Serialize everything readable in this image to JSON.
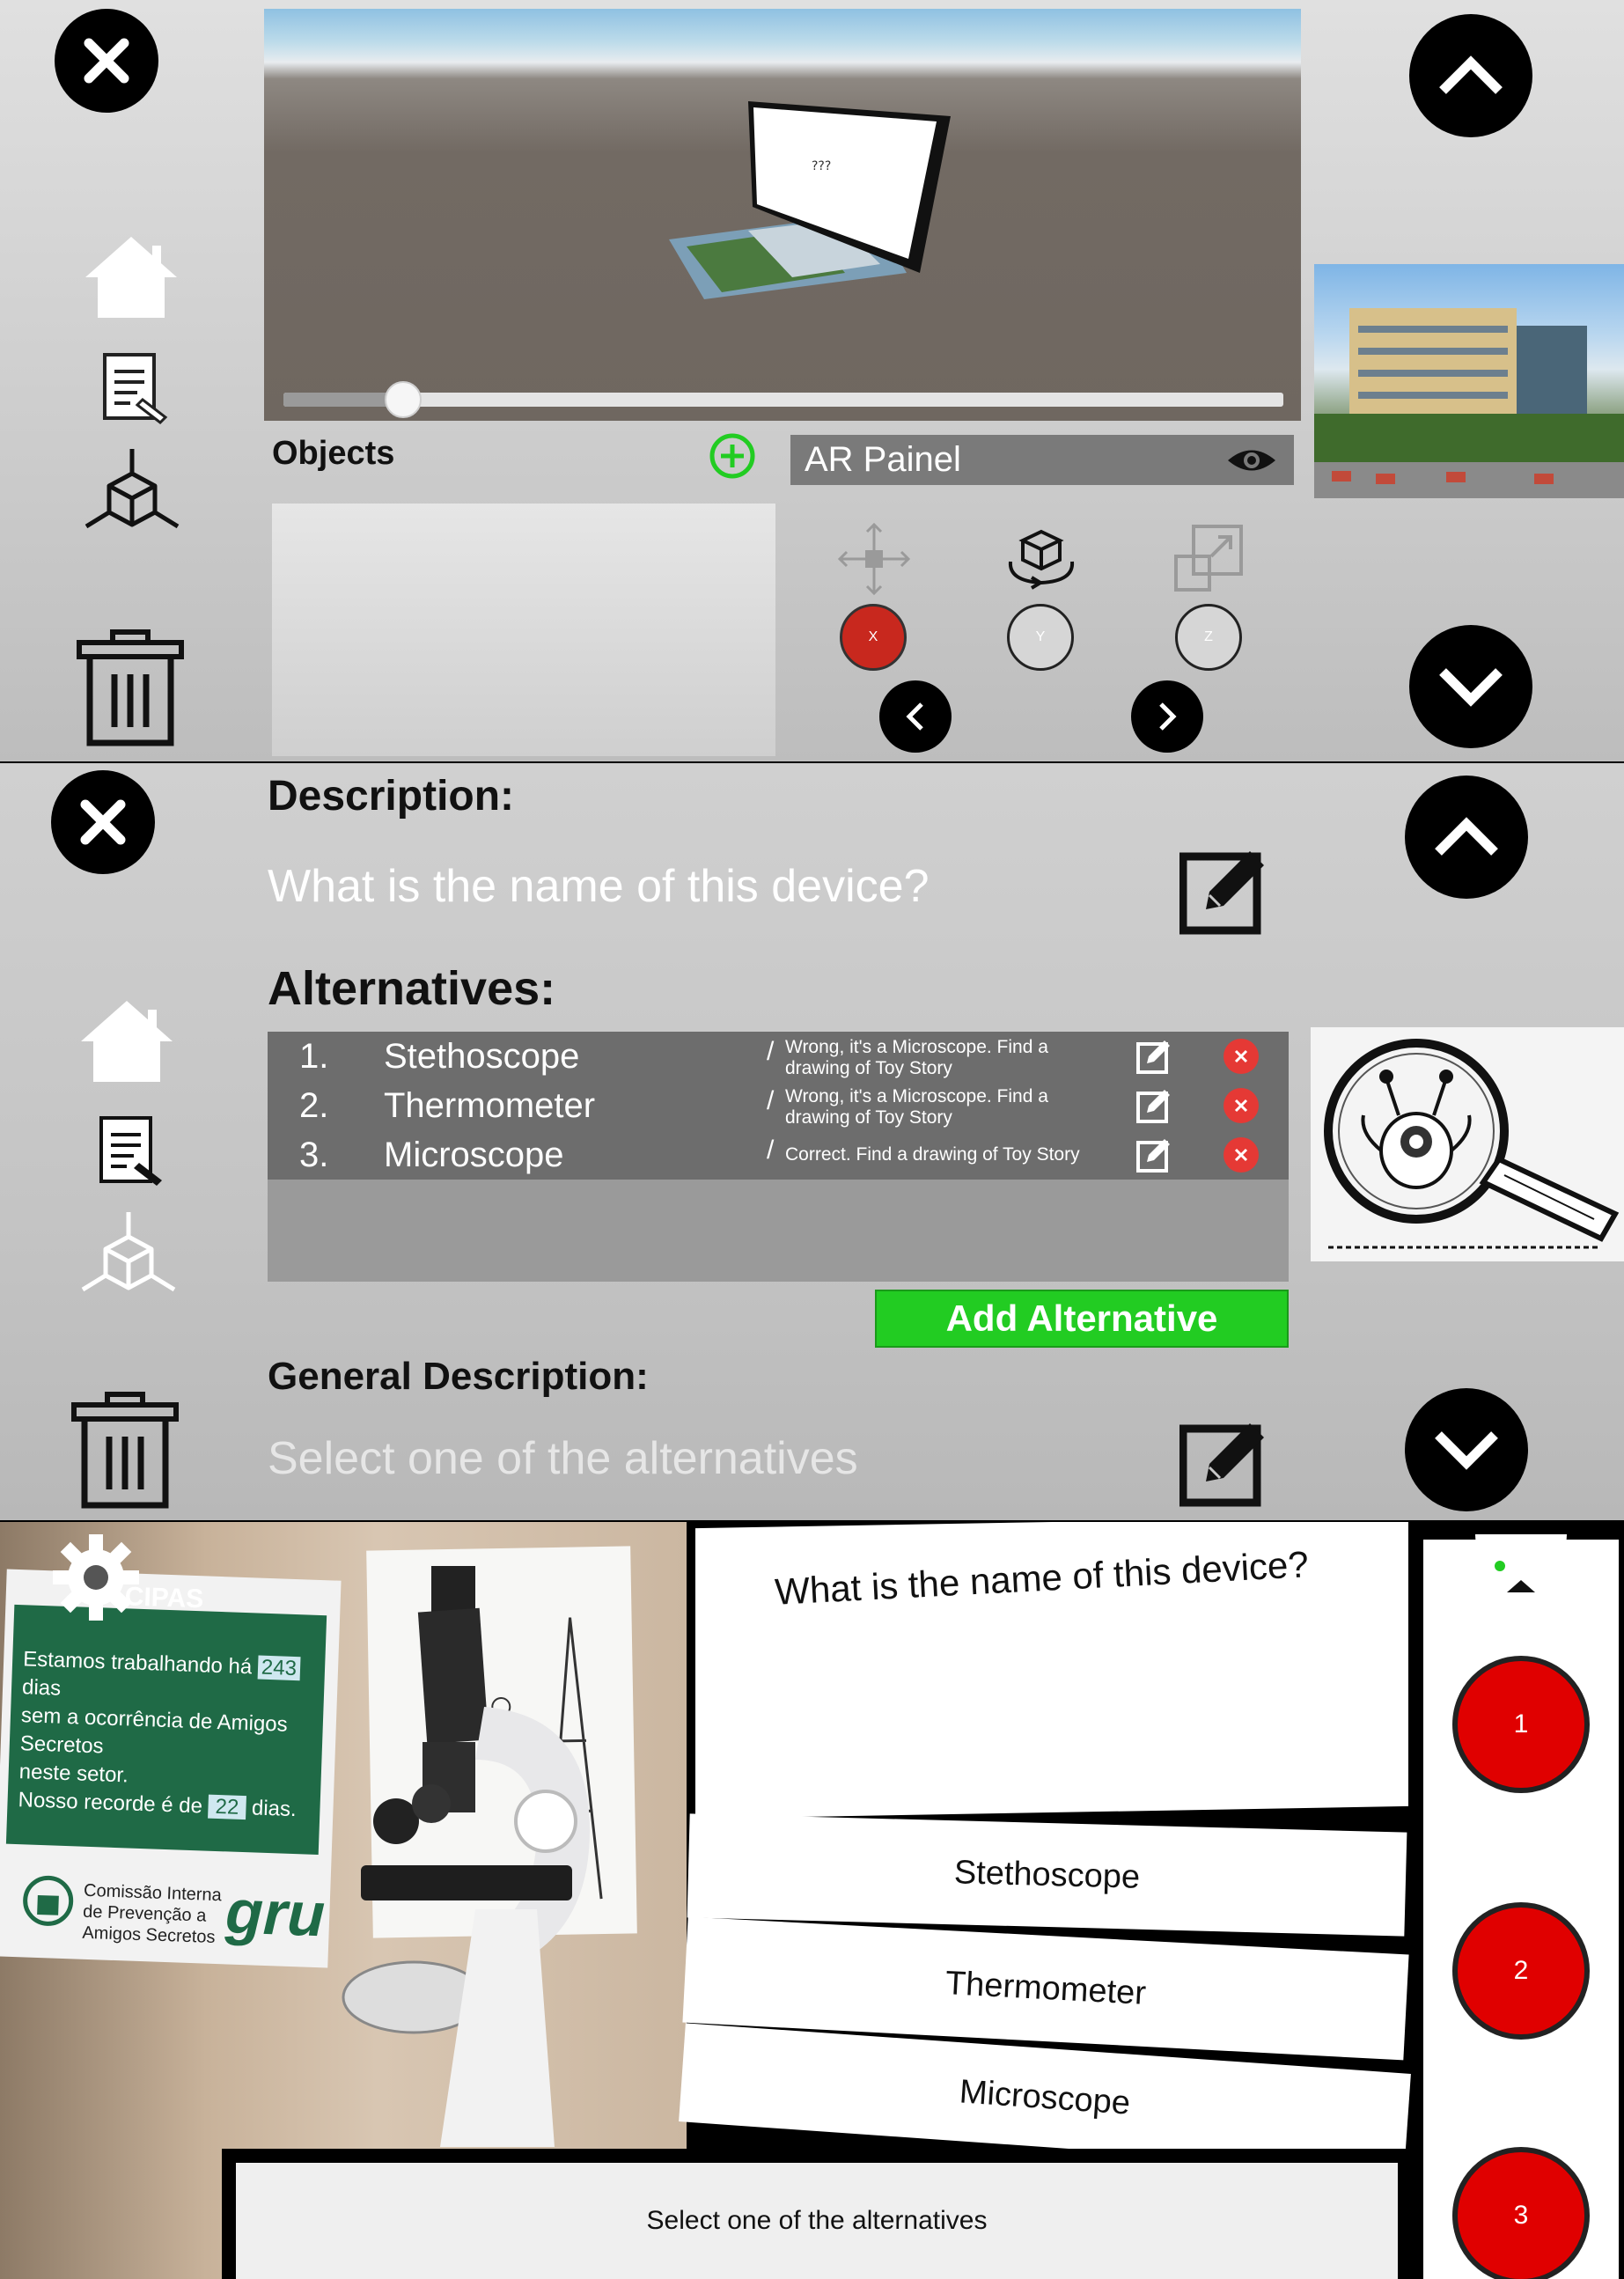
{
  "editor_top": {
    "objects_title": "Objects",
    "ar_panel_label": "AR Painel",
    "axis_buttons": [
      "X",
      "Y",
      "Z"
    ],
    "slider_value_fraction": 0.12,
    "card_text": "???"
  },
  "editor_question": {
    "description_label": "Description:",
    "description_text": "What is the name of this device?",
    "alternatives_label": "Alternatives:",
    "alternatives": [
      {
        "num": "1.",
        "name": "Stethoscope",
        "feedback": "Wrong, it's a Microscope. Find a drawing of Toy Story"
      },
      {
        "num": "2.",
        "name": "Thermometer",
        "feedback": "Wrong, it's a Microscope. Find a drawing of Toy Story"
      },
      {
        "num": "3.",
        "name": "Microscope",
        "feedback": "Correct. Find a drawing of Toy Story"
      }
    ],
    "add_alternative_label": "Add Alternative",
    "general_description_label": "General Description:",
    "general_description_placeholder": "Select one of the alternatives"
  },
  "ar_view": {
    "question": "What is the name of this device?",
    "options": [
      "Stethoscope",
      "Thermometer",
      "Microscope"
    ],
    "answer_buttons": [
      "1",
      "2",
      "3"
    ],
    "footer_text": "Select one of the alternatives",
    "poster": {
      "title": "CIPAS",
      "line1": "Estamos trabalhando há",
      "counter": "243",
      "line1b": "dias",
      "line2": "sem a ocorrência de Amigos Secretos",
      "line3": "neste setor.",
      "line4": "Nosso recorde é de",
      "record": "22",
      "line4b": "dias.",
      "footer": "Comissão Interna de Prevenção a Amigos Secretos",
      "logo": "gru"
    }
  },
  "colors": {
    "accent_green": "#22cc22",
    "delete_red": "#e53935",
    "answer_red": "#e00000",
    "axis_active": "#c8281e"
  }
}
